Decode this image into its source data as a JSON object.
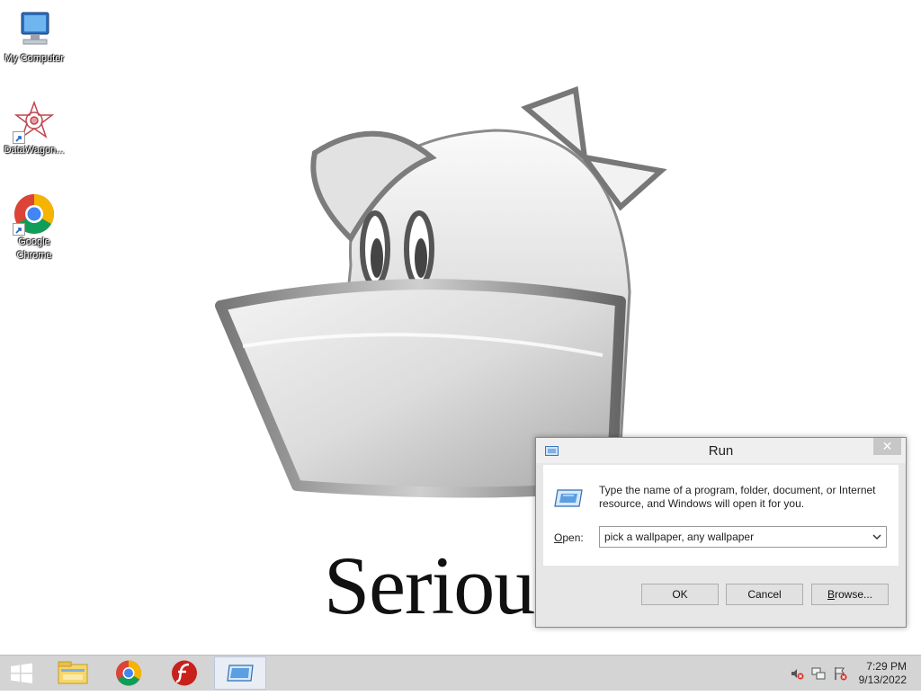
{
  "desktop": {
    "icons": [
      {
        "label": "My Computer",
        "icon": "my-computer-icon"
      },
      {
        "label": "DataWagon...",
        "icon": "datawagon-icon"
      },
      {
        "label": "Google Chrome",
        "icon": "google-chrome-icon"
      }
    ],
    "wallpaper_text": "Seriousl"
  },
  "run_dialog": {
    "title": "Run",
    "close_glyph": "✕",
    "description": "Type the name of a program, folder, document, or Internet resource, and Windows will open it for you.",
    "open_label_underlined": "O",
    "open_label_rest": "pen:",
    "open_value": "pick a wallpaper, any wallpaper",
    "ok_label": "OK",
    "cancel_label": "Cancel",
    "browse_label_underlined": "B",
    "browse_label_rest": "rowse..."
  },
  "taskbar": {
    "items": [
      {
        "icon": "file-explorer-icon"
      },
      {
        "icon": "google-chrome-icon"
      },
      {
        "icon": "flash-icon"
      },
      {
        "icon": "run-icon"
      }
    ],
    "tray": {
      "icons": [
        "volume-muted-icon",
        "network-icon",
        "action-center-icon"
      ],
      "time": "7:29 PM",
      "date": "9/13/2022"
    }
  },
  "colors": {
    "taskbar": "#d4d4d4",
    "dialog_bg": "#e7e7e7",
    "close_button": "#c7c7c7"
  }
}
